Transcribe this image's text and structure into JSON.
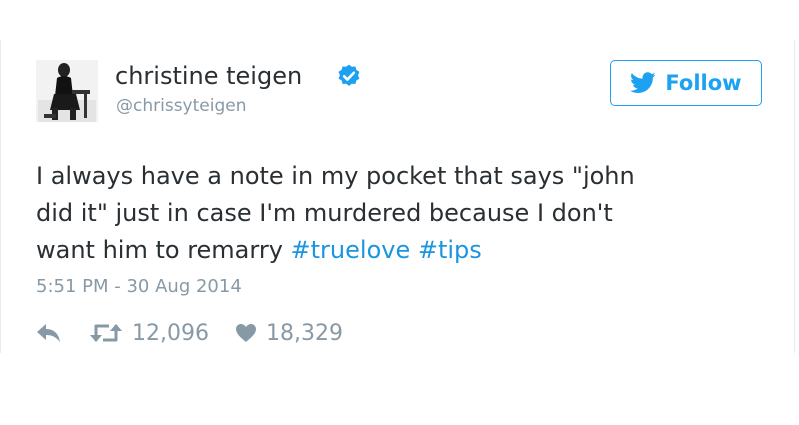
{
  "author": {
    "name": "christine teigen",
    "handle": "@chrissyteigen",
    "verified": true
  },
  "follow_button": {
    "label": "Follow",
    "icon": "twitter-bird-icon"
  },
  "tweet": {
    "lines": [
      {
        "segments": [
          {
            "text": "I always have a note in my pocket that says \"john",
            "hashtag": false
          }
        ]
      },
      {
        "segments": [
          {
            "text": "did it\" just in case I'm murdered because I don't",
            "hashtag": false
          }
        ]
      },
      {
        "segments": [
          {
            "text": "want him to remarry ",
            "hashtag": false
          },
          {
            "text": "#truelove",
            "hashtag": true
          },
          {
            "text": " ",
            "hashtag": false
          },
          {
            "text": "#tips",
            "hashtag": true
          }
        ]
      }
    ],
    "timestamp": "5:51 PM - 30 Aug 2014"
  },
  "actions": {
    "reply": {
      "icon": "reply-icon"
    },
    "retweet": {
      "icon": "retweet-icon",
      "count": "12,096"
    },
    "like": {
      "icon": "heart-icon",
      "count": "18,329"
    }
  },
  "colors": {
    "accent": "#1da1f2",
    "hashtag": "#1b95e0",
    "text": "#292f33",
    "muted": "#8899a6"
  }
}
